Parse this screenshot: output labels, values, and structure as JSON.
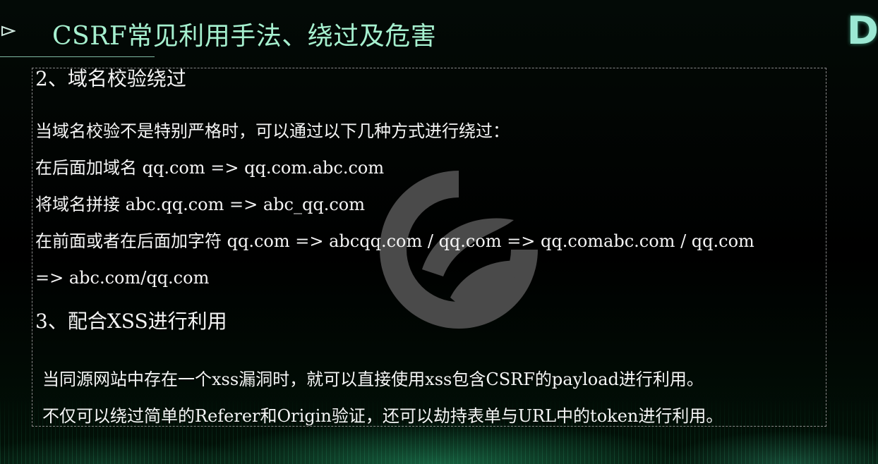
{
  "slide": {
    "title": "CSRF常见利用手法、绕过及危害",
    "brand_letter": "D"
  },
  "sections": [
    {
      "heading": "2、域名校验绕过",
      "lines": [
        "当域名校验不是特别严格时，可以通过以下几种方式进行绕过：",
        "在后面加域名 qq.com => qq.com.abc.com",
        "将域名拼接 abc.qq.com => abc_qq.com",
        "在前面或者在后面加字符 qq.com => abcqq.com / qq.com => qq.comabc.com / qq.com",
        "=> abc.com/qq.com"
      ]
    },
    {
      "heading": "3、配合XSS进行利用",
      "lines": [
        "当同源网站中存在一个xss漏洞时，就可以直接使用xss包含CSRF的payload进行利用。",
        "不仅可以绕过简单的Referer和Origin验证，还可以劫持表单与URL中的token进行利用。"
      ]
    }
  ],
  "colors": {
    "title": "#a6f0cf",
    "text": "#f5f5f5",
    "accent": "#3aa878",
    "watermark": "#4a4a4a"
  },
  "icons": {
    "bullet": "play-outline-icon",
    "watermark": "circular-e-logo-icon"
  }
}
